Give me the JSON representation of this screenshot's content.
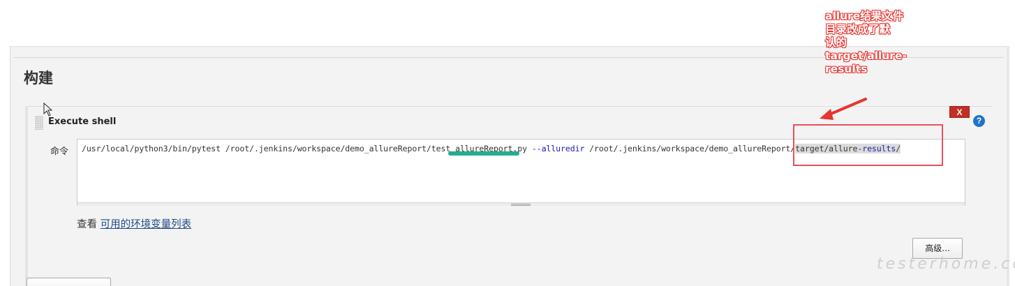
{
  "section": {
    "title": "构建"
  },
  "build_step": {
    "title": "Execute shell",
    "delete_label": "X",
    "help_label": "?",
    "command_label": "命令",
    "command": {
      "part1": "/usr/local/python3/bin/pytest /root/.jenkins/workspace/demo_allureReport/test_allureReport.py ",
      "flag": "--alluredir",
      "part2": " /root/.jenkins/workspace/demo_allureReport/",
      "selected_a": "target/allure",
      "selected_b": "-results",
      "selected_c": "/"
    },
    "env_prefix": "查看 ",
    "env_link": "可用的环境变量列表",
    "advanced_label": "高级..."
  },
  "annotation": {
    "lines": [
      "allure结果文件",
      "目录改成了默",
      "认的",
      "target/allure-",
      "results"
    ],
    "color": "#e8342f"
  },
  "watermark": "testerhome.com"
}
